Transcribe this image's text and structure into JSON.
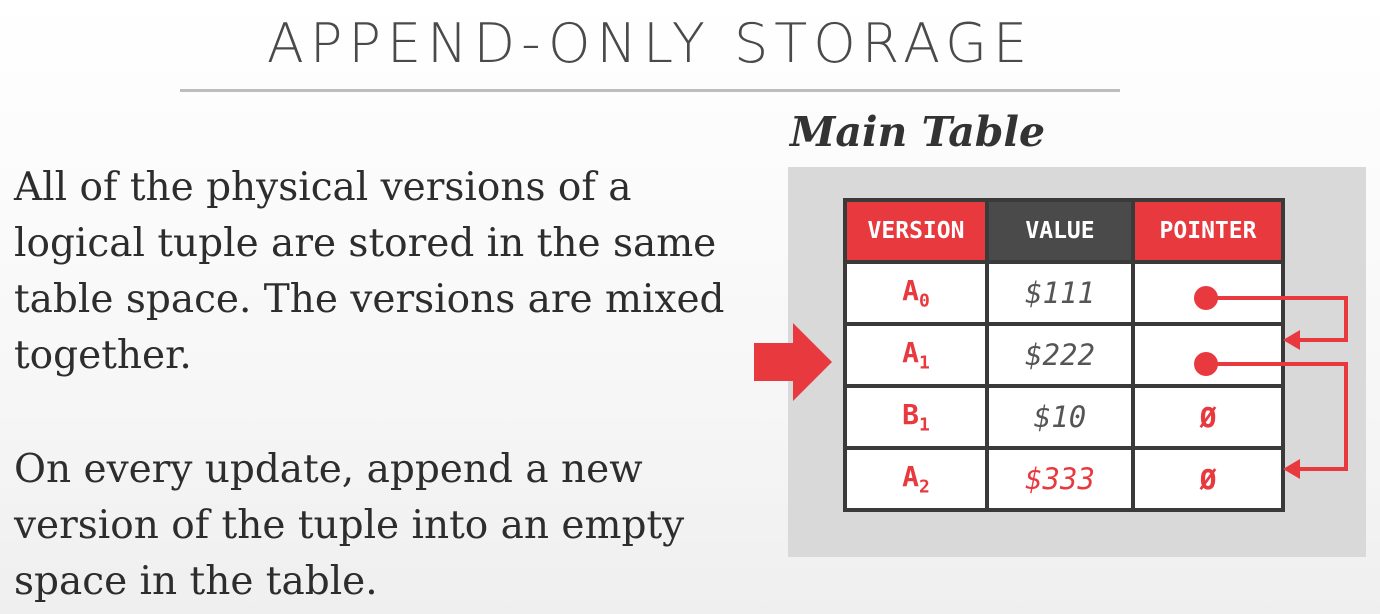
{
  "slide": {
    "title": "APPEND-ONLY STORAGE",
    "paragraphs": [
      "All of the physical versions of a logical tuple are stored in the same table space. The versions are mixed together.",
      "On every update, append a new version of the tuple into an empty space in the table."
    ]
  },
  "figure": {
    "caption": "Main Table",
    "headers": [
      "VERSION",
      "VALUE",
      "POINTER"
    ],
    "rows": [
      {
        "key": "A",
        "sub": "0",
        "value": "$111",
        "pointer": "",
        "pointer_icon": "dot",
        "value_highlight": false
      },
      {
        "key": "A",
        "sub": "1",
        "value": "$222",
        "pointer": "",
        "pointer_icon": "dot",
        "value_highlight": false
      },
      {
        "key": "B",
        "sub": "1",
        "value": "$10",
        "pointer": "Ø",
        "pointer_icon": "null",
        "value_highlight": false
      },
      {
        "key": "A",
        "sub": "2",
        "value": "$333",
        "pointer": "Ø",
        "pointer_icon": "null",
        "value_highlight": true
      }
    ],
    "current_row_marker_icon": "right-arrow-icon",
    "colors": {
      "accent": "#e8393f",
      "dark_header": "#4a4a4a",
      "panel": "#d9d9d9"
    }
  }
}
